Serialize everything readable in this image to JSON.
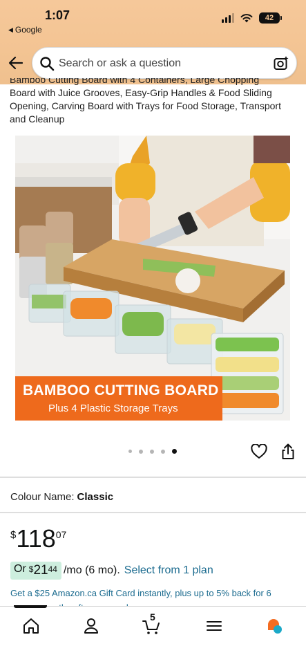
{
  "status": {
    "time": "1:07",
    "back_app": "Google",
    "battery": "42"
  },
  "search": {
    "placeholder": "Search or ask a question"
  },
  "product": {
    "title_lines": [
      "Bamboo Cutting Board with 4 Containers, Large Chopping",
      "Board with Juice Grooves, Easy-Grip Handles & Food Sliding",
      "Opening, Carving Board with Trays for Food Storage, Transport",
      "and Cleanup"
    ],
    "banner_title": "BAMBOO CUTTING BOARD",
    "banner_subtitle": "Plus 4 Plastic Storage Trays",
    "image_count": 5,
    "active_image_index": 4,
    "colour_label": "Colour Name:",
    "colour_value": "Classic",
    "price": {
      "symbol": "$",
      "whole": "118",
      "cents": "07"
    },
    "plan": {
      "prefix": "Or",
      "symbol": "$",
      "whole": "21",
      "cents": "44",
      "per": "/mo (6 mo).",
      "link": "Select from 1 plan"
    },
    "gift_text": "Get a $25 Amazon.ca Gift Card instantly, plus up to 5% back for 6",
    "gift_text_cut": "months after approval"
  },
  "nav": {
    "items": [
      "home-icon",
      "account-icon",
      "cart-icon",
      "menu-icon",
      "rufus-icon"
    ],
    "cart_count": "5"
  },
  "colors": {
    "header_bg": "#f3c493",
    "banner_bg": "#ee6a1c",
    "link": "#1b6b8f",
    "plan_pill": "#cdeede"
  }
}
